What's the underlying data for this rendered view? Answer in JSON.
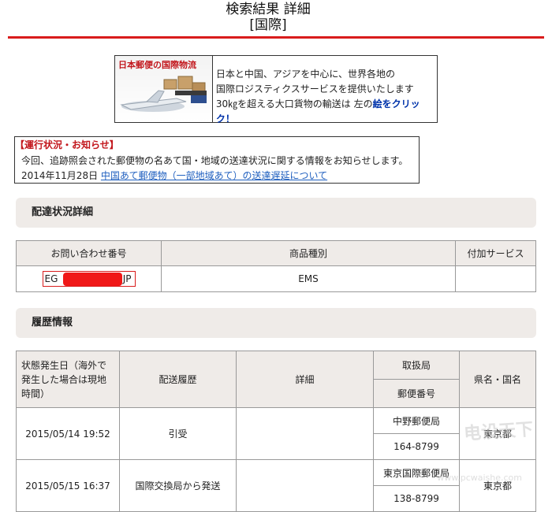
{
  "header": {
    "title_line1": "検索結果 詳細",
    "title_line2": "[国際]"
  },
  "banner": {
    "caption": "日本郵便の国際物流",
    "line1": "日本と中国、アジアを中心に、世界各地の",
    "line2": "国際ロジスティクスサービスを提供いたします",
    "line3_pre": "30㎏を超える大口貨物の輸送は 左の",
    "line3_link": "絵をクリック！"
  },
  "notice": {
    "heading": "【運行状況・お知らせ】",
    "body": "今回、追跡照会された郵便物の名あて国・地域の送達状況に関する情報をお知らせします。",
    "date": "2014年11月28日",
    "link": "中国あて郵便物（一部地域あて）の送達遅延について"
  },
  "section1": {
    "title": "配達状況詳細"
  },
  "table1": {
    "headers": [
      "お問い合わせ番号",
      "商品種別",
      "付加サービス"
    ],
    "row": {
      "tracking_prefix": "EG",
      "tracking_suffix": "JP",
      "type": "EMS",
      "service": ""
    }
  },
  "section2": {
    "title": "履歴情報"
  },
  "table2": {
    "headers": {
      "date": "状態発生日（海外で発生した場合は現地時間）",
      "history": "配送履歴",
      "detail": "詳細",
      "office": "取扱局",
      "postal": "郵便番号",
      "pref": "県名・国名"
    },
    "rows": [
      {
        "date": "2015/05/14 19:52",
        "history": "引受",
        "detail": "",
        "office": "中野郵便局",
        "postal": "164-8799",
        "pref": "東京都"
      },
      {
        "date": "2015/05/15 16:37",
        "history": "国際交換局から発送",
        "detail": "",
        "office": "東京国際郵便局",
        "postal": "138-8799",
        "pref": "東京都"
      }
    ]
  },
  "watermark": {
    "text": "电设天下",
    "url": "www.pcwaishe.com"
  }
}
